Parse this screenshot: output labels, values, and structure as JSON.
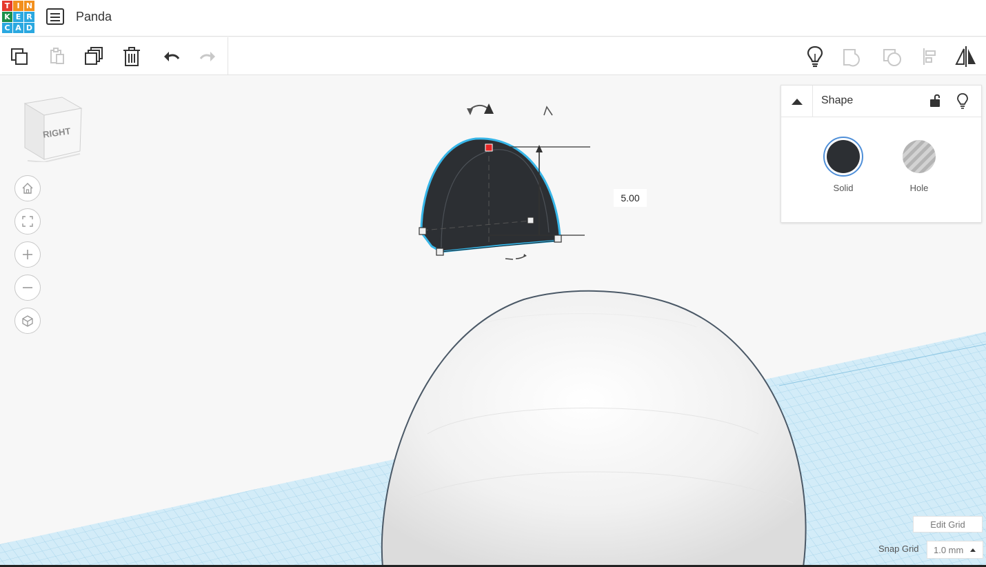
{
  "header": {
    "logo_letters": [
      "T",
      "I",
      "N",
      "K",
      "E",
      "R",
      "C",
      "A",
      "D"
    ],
    "logo_colors": [
      "#e5392b",
      "#f28f1d",
      "#f28f1d",
      "#1c8f4a",
      "#2aa8e0",
      "#2aa8e0",
      "#2aa8e0",
      "#2aa8e0",
      "#2aa8e0"
    ],
    "project_title": "Panda"
  },
  "toolbar": {
    "left_tools": [
      "copy-icon",
      "paste-icon",
      "duplicate-icon",
      "trash-icon",
      "undo-icon",
      "redo-icon"
    ],
    "right_tools": [
      "bulb-icon",
      "group-icon",
      "ungroup-icon",
      "align-icon",
      "mirror-icon"
    ]
  },
  "viewcube": {
    "label": "RIGHT"
  },
  "nav_controls": [
    "home-icon",
    "fit-icon",
    "zoom-in-icon",
    "zoom-out-icon",
    "perspective-icon"
  ],
  "shape_panel": {
    "title": "Shape",
    "solid_label": "Solid",
    "hole_label": "Hole"
  },
  "dimension": {
    "value": "5.00"
  },
  "grid": {
    "edit_label": "Edit Grid",
    "snap_label": "Snap Grid",
    "snap_value": "1.0 mm"
  },
  "colors": {
    "selection_outline": "#37b6e8",
    "shape_fill": "#2c2f33",
    "handle_red": "#e52626",
    "workplane": "#cfe9f6",
    "grid_line": "#9ccfe8",
    "accent": "#4f8fd8"
  }
}
